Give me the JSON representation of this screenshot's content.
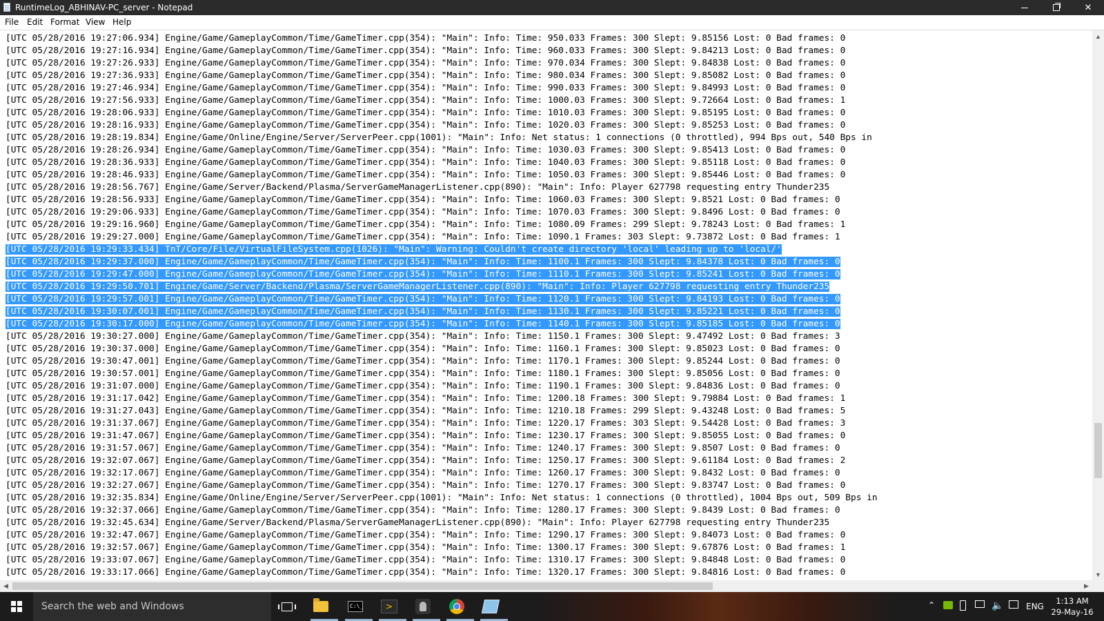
{
  "window": {
    "title": "RuntimeLog_ABHINAV-PC_server - Notepad"
  },
  "menu": [
    "File",
    "Edit",
    "Format",
    "View",
    "Help"
  ],
  "editor": {
    "selection_color": "#3399ff",
    "lines": [
      {
        "text": "[UTC 05/28/2016 19:27:06.934] Engine/Game/GameplayCommon/Time/GameTimer.cpp(354): \"Main\": Info: Time: 950.033 Frames: 300 Slept: 9.85156 Lost: 0 Bad frames: 0",
        "selected": false
      },
      {
        "text": "[UTC 05/28/2016 19:27:16.934] Engine/Game/GameplayCommon/Time/GameTimer.cpp(354): \"Main\": Info: Time: 960.033 Frames: 300 Slept: 9.84213 Lost: 0 Bad frames: 0",
        "selected": false
      },
      {
        "text": "[UTC 05/28/2016 19:27:26.933] Engine/Game/GameplayCommon/Time/GameTimer.cpp(354): \"Main\": Info: Time: 970.034 Frames: 300 Slept: 9.84838 Lost: 0 Bad frames: 0",
        "selected": false
      },
      {
        "text": "[UTC 05/28/2016 19:27:36.933] Engine/Game/GameplayCommon/Time/GameTimer.cpp(354): \"Main\": Info: Time: 980.034 Frames: 300 Slept: 9.85082 Lost: 0 Bad frames: 0",
        "selected": false
      },
      {
        "text": "[UTC 05/28/2016 19:27:46.934] Engine/Game/GameplayCommon/Time/GameTimer.cpp(354): \"Main\": Info: Time: 990.033 Frames: 300 Slept: 9.84993 Lost: 0 Bad frames: 0",
        "selected": false
      },
      {
        "text": "[UTC 05/28/2016 19:27:56.933] Engine/Game/GameplayCommon/Time/GameTimer.cpp(354): \"Main\": Info: Time: 1000.03 Frames: 300 Slept: 9.72664 Lost: 0 Bad frames: 1",
        "selected": false
      },
      {
        "text": "[UTC 05/28/2016 19:28:06.933] Engine/Game/GameplayCommon/Time/GameTimer.cpp(354): \"Main\": Info: Time: 1010.03 Frames: 300 Slept: 9.85195 Lost: 0 Bad frames: 0",
        "selected": false
      },
      {
        "text": "[UTC 05/28/2016 19:28:16.933] Engine/Game/GameplayCommon/Time/GameTimer.cpp(354): \"Main\": Info: Time: 1020.03 Frames: 300 Slept: 9.85253 Lost: 0 Bad frames: 0",
        "selected": false
      },
      {
        "text": "[UTC 05/28/2016 19:28:19.834] Engine/Game/Online/Engine/Server/ServerPeer.cpp(1001): \"Main\": Info: Net status: 1 connections (0 throttled), 994 Bps out, 540 Bps in",
        "selected": false
      },
      {
        "text": "[UTC 05/28/2016 19:28:26.934] Engine/Game/GameplayCommon/Time/GameTimer.cpp(354): \"Main\": Info: Time: 1030.03 Frames: 300 Slept: 9.85413 Lost: 0 Bad frames: 0",
        "selected": false
      },
      {
        "text": "[UTC 05/28/2016 19:28:36.933] Engine/Game/GameplayCommon/Time/GameTimer.cpp(354): \"Main\": Info: Time: 1040.03 Frames: 300 Slept: 9.85118 Lost: 0 Bad frames: 0",
        "selected": false
      },
      {
        "text": "[UTC 05/28/2016 19:28:46.933] Engine/Game/GameplayCommon/Time/GameTimer.cpp(354): \"Main\": Info: Time: 1050.03 Frames: 300 Slept: 9.85446 Lost: 0 Bad frames: 0",
        "selected": false
      },
      {
        "text": "[UTC 05/28/2016 19:28:56.767] Engine/Game/Server/Backend/Plasma/ServerGameManagerListener.cpp(890): \"Main\": Info: Player 627798 requesting entry Thunder235",
        "selected": false
      },
      {
        "text": "[UTC 05/28/2016 19:28:56.933] Engine/Game/GameplayCommon/Time/GameTimer.cpp(354): \"Main\": Info: Time: 1060.03 Frames: 300 Slept: 9.8521 Lost: 0 Bad frames: 0",
        "selected": false
      },
      {
        "text": "[UTC 05/28/2016 19:29:06.933] Engine/Game/GameplayCommon/Time/GameTimer.cpp(354): \"Main\": Info: Time: 1070.03 Frames: 300 Slept: 9.8496 Lost: 0 Bad frames: 0",
        "selected": false
      },
      {
        "text": "[UTC 05/28/2016 19:29:16.960] Engine/Game/GameplayCommon/Time/GameTimer.cpp(354): \"Main\": Info: Time: 1080.09 Frames: 299 Slept: 9.78243 Lost: 0 Bad frames: 1",
        "selected": false
      },
      {
        "text": "[UTC 05/28/2016 19:29:27.000] Engine/Game/GameplayCommon/Time/GameTimer.cpp(354): \"Main\": Info: Time: 1090.1 Frames: 303 Slept: 9.73872 Lost: 0 Bad frames: 1",
        "selected": false
      },
      {
        "text": "[UTC 05/28/2016 19:29:33.434] TnT/Core/File/VirtualFileSystem.cpp(1026): \"Main\": Warning: Couldn't create directory 'local' leading up to 'local/'",
        "selected": true
      },
      {
        "text": "[UTC 05/28/2016 19:29:37.000] Engine/Game/GameplayCommon/Time/GameTimer.cpp(354): \"Main\": Info: Time: 1100.1 Frames: 300 Slept: 9.84378 Lost: 0 Bad frames: 0",
        "selected": true
      },
      {
        "text": "[UTC 05/28/2016 19:29:47.000] Engine/Game/GameplayCommon/Time/GameTimer.cpp(354): \"Main\": Info: Time: 1110.1 Frames: 300 Slept: 9.85241 Lost: 0 Bad frames: 0",
        "selected": true
      },
      {
        "text": "[UTC 05/28/2016 19:29:50.701] Engine/Game/Server/Backend/Plasma/ServerGameManagerListener.cpp(890): \"Main\": Info: Player 627798 requesting entry Thunder235",
        "selected": true
      },
      {
        "text": "[UTC 05/28/2016 19:29:57.001] Engine/Game/GameplayCommon/Time/GameTimer.cpp(354): \"Main\": Info: Time: 1120.1 Frames: 300 Slept: 9.84193 Lost: 0 Bad frames: 0",
        "selected": true
      },
      {
        "text": "[UTC 05/28/2016 19:30:07.001] Engine/Game/GameplayCommon/Time/GameTimer.cpp(354): \"Main\": Info: Time: 1130.1 Frames: 300 Slept: 9.85221 Lost: 0 Bad frames: 0",
        "selected": true
      },
      {
        "text": "[UTC 05/28/2016 19:30:17.000] Engine/Game/GameplayCommon/Time/GameTimer.cpp(354): \"Main\": Info: Time: 1140.1 Frames: 300 Slept: 9.85185 Lost: 0 Bad frames: 0",
        "selected": true
      },
      {
        "text": "[UTC 05/28/2016 19:30:27.000] Engine/Game/GameplayCommon/Time/GameTimer.cpp(354): \"Main\": Info: Time: 1150.1 Frames: 300 Slept: 9.47492 Lost: 0 Bad frames: 3",
        "selected": false
      },
      {
        "text": "[UTC 05/28/2016 19:30:37.000] Engine/Game/GameplayCommon/Time/GameTimer.cpp(354): \"Main\": Info: Time: 1160.1 Frames: 300 Slept: 9.85023 Lost: 0 Bad frames: 0",
        "selected": false
      },
      {
        "text": "[UTC 05/28/2016 19:30:47.001] Engine/Game/GameplayCommon/Time/GameTimer.cpp(354): \"Main\": Info: Time: 1170.1 Frames: 300 Slept: 9.85244 Lost: 0 Bad frames: 0",
        "selected": false
      },
      {
        "text": "[UTC 05/28/2016 19:30:57.001] Engine/Game/GameplayCommon/Time/GameTimer.cpp(354): \"Main\": Info: Time: 1180.1 Frames: 300 Slept: 9.85056 Lost: 0 Bad frames: 0",
        "selected": false
      },
      {
        "text": "[UTC 05/28/2016 19:31:07.000] Engine/Game/GameplayCommon/Time/GameTimer.cpp(354): \"Main\": Info: Time: 1190.1 Frames: 300 Slept: 9.84836 Lost: 0 Bad frames: 0",
        "selected": false
      },
      {
        "text": "[UTC 05/28/2016 19:31:17.042] Engine/Game/GameplayCommon/Time/GameTimer.cpp(354): \"Main\": Info: Time: 1200.18 Frames: 300 Slept: 9.79884 Lost: 0 Bad frames: 1",
        "selected": false
      },
      {
        "text": "[UTC 05/28/2016 19:31:27.043] Engine/Game/GameplayCommon/Time/GameTimer.cpp(354): \"Main\": Info: Time: 1210.18 Frames: 299 Slept: 9.43248 Lost: 0 Bad frames: 5",
        "selected": false
      },
      {
        "text": "[UTC 05/28/2016 19:31:37.067] Engine/Game/GameplayCommon/Time/GameTimer.cpp(354): \"Main\": Info: Time: 1220.17 Frames: 303 Slept: 9.54428 Lost: 0 Bad frames: 3",
        "selected": false
      },
      {
        "text": "[UTC 05/28/2016 19:31:47.067] Engine/Game/GameplayCommon/Time/GameTimer.cpp(354): \"Main\": Info: Time: 1230.17 Frames: 300 Slept: 9.85055 Lost: 0 Bad frames: 0",
        "selected": false
      },
      {
        "text": "[UTC 05/28/2016 19:31:57.067] Engine/Game/GameplayCommon/Time/GameTimer.cpp(354): \"Main\": Info: Time: 1240.17 Frames: 300 Slept: 9.8507 Lost: 0 Bad frames: 0",
        "selected": false
      },
      {
        "text": "[UTC 05/28/2016 19:32:07.067] Engine/Game/GameplayCommon/Time/GameTimer.cpp(354): \"Main\": Info: Time: 1250.17 Frames: 300 Slept: 9.61184 Lost: 0 Bad frames: 2",
        "selected": false
      },
      {
        "text": "[UTC 05/28/2016 19:32:17.067] Engine/Game/GameplayCommon/Time/GameTimer.cpp(354): \"Main\": Info: Time: 1260.17 Frames: 300 Slept: 9.8432 Lost: 0 Bad frames: 0",
        "selected": false
      },
      {
        "text": "[UTC 05/28/2016 19:32:27.067] Engine/Game/GameplayCommon/Time/GameTimer.cpp(354): \"Main\": Info: Time: 1270.17 Frames: 300 Slept: 9.83747 Lost: 0 Bad frames: 0",
        "selected": false
      },
      {
        "text": "[UTC 05/28/2016 19:32:35.834] Engine/Game/Online/Engine/Server/ServerPeer.cpp(1001): \"Main\": Info: Net status: 1 connections (0 throttled), 1004 Bps out, 509 Bps in",
        "selected": false
      },
      {
        "text": "[UTC 05/28/2016 19:32:37.066] Engine/Game/GameplayCommon/Time/GameTimer.cpp(354): \"Main\": Info: Time: 1280.17 Frames: 300 Slept: 9.8439 Lost: 0 Bad frames: 0",
        "selected": false
      },
      {
        "text": "[UTC 05/28/2016 19:32:45.634] Engine/Game/Server/Backend/Plasma/ServerGameManagerListener.cpp(890): \"Main\": Info: Player 627798 requesting entry Thunder235",
        "selected": false
      },
      {
        "text": "[UTC 05/28/2016 19:32:47.067] Engine/Game/GameplayCommon/Time/GameTimer.cpp(354): \"Main\": Info: Time: 1290.17 Frames: 300 Slept: 9.84073 Lost: 0 Bad frames: 0",
        "selected": false
      },
      {
        "text": "[UTC 05/28/2016 19:32:57.067] Engine/Game/GameplayCommon/Time/GameTimer.cpp(354): \"Main\": Info: Time: 1300.17 Frames: 300 Slept: 9.67876 Lost: 0 Bad frames: 1",
        "selected": false
      },
      {
        "text": "[UTC 05/28/2016 19:33:07.067] Engine/Game/GameplayCommon/Time/GameTimer.cpp(354): \"Main\": Info: Time: 1310.17 Frames: 300 Slept: 9.84848 Lost: 0 Bad frames: 0",
        "selected": false
      },
      {
        "text": "[UTC 05/28/2016 19:33:17.066] Engine/Game/GameplayCommon/Time/GameTimer.cpp(354): \"Main\": Info: Time: 1320.17 Frames: 300 Slept: 9.84816 Lost: 0 Bad frames: 0",
        "selected": false
      }
    ]
  },
  "taskbar": {
    "search_placeholder": "Search the web and Windows",
    "apps": [
      "task-view-icon",
      "file-explorer-icon",
      "command-prompt-icon",
      "powershell-icon",
      "game-icon",
      "chrome-icon",
      "notepad-icon"
    ],
    "tray": {
      "language": "ENG",
      "time": "1:13 AM",
      "date": "29-May-16"
    }
  }
}
